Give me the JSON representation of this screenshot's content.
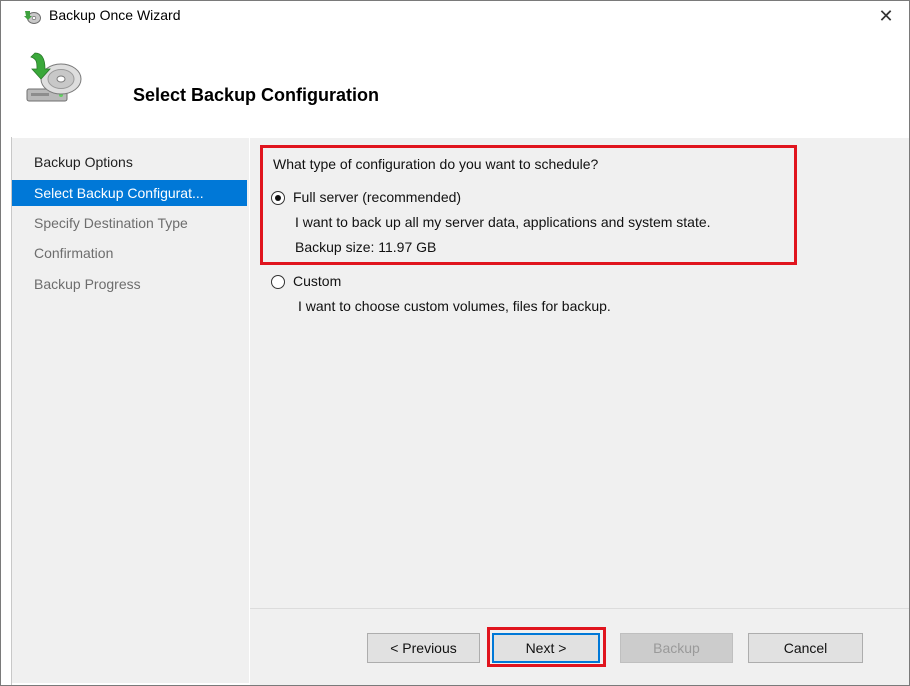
{
  "window": {
    "title": "Backup Once Wizard",
    "close_glyph": "✕"
  },
  "header": {
    "title": "Select Backup Configuration"
  },
  "nav": {
    "items": [
      {
        "label": "Backup Options",
        "state": "done"
      },
      {
        "label": "Select Backup Configurat...",
        "state": "active"
      },
      {
        "label": "Specify Destination Type",
        "state": "pending"
      },
      {
        "label": "Confirmation",
        "state": "pending"
      },
      {
        "label": "Backup Progress",
        "state": "pending"
      }
    ]
  },
  "main": {
    "question": "What type of configuration do you want to schedule?",
    "options": [
      {
        "label": "Full server (recommended)",
        "selected": true,
        "description": "I want to back up all my server data, applications and system state.",
        "size_text": "Backup size: 11.97 GB"
      },
      {
        "label": "Custom",
        "selected": false,
        "description": "I want to choose custom volumes, files for backup."
      }
    ]
  },
  "footer": {
    "previous_label": "< Previous",
    "next_label": "Next >",
    "backup_label": "Backup",
    "cancel_label": "Cancel"
  },
  "colors": {
    "accent": "#0078d7",
    "highlight": "#e0141e",
    "panel": "#f0f0f0"
  },
  "icons": {
    "title_icon": "backup-icon",
    "header_icon": "backup-disk-icon"
  }
}
